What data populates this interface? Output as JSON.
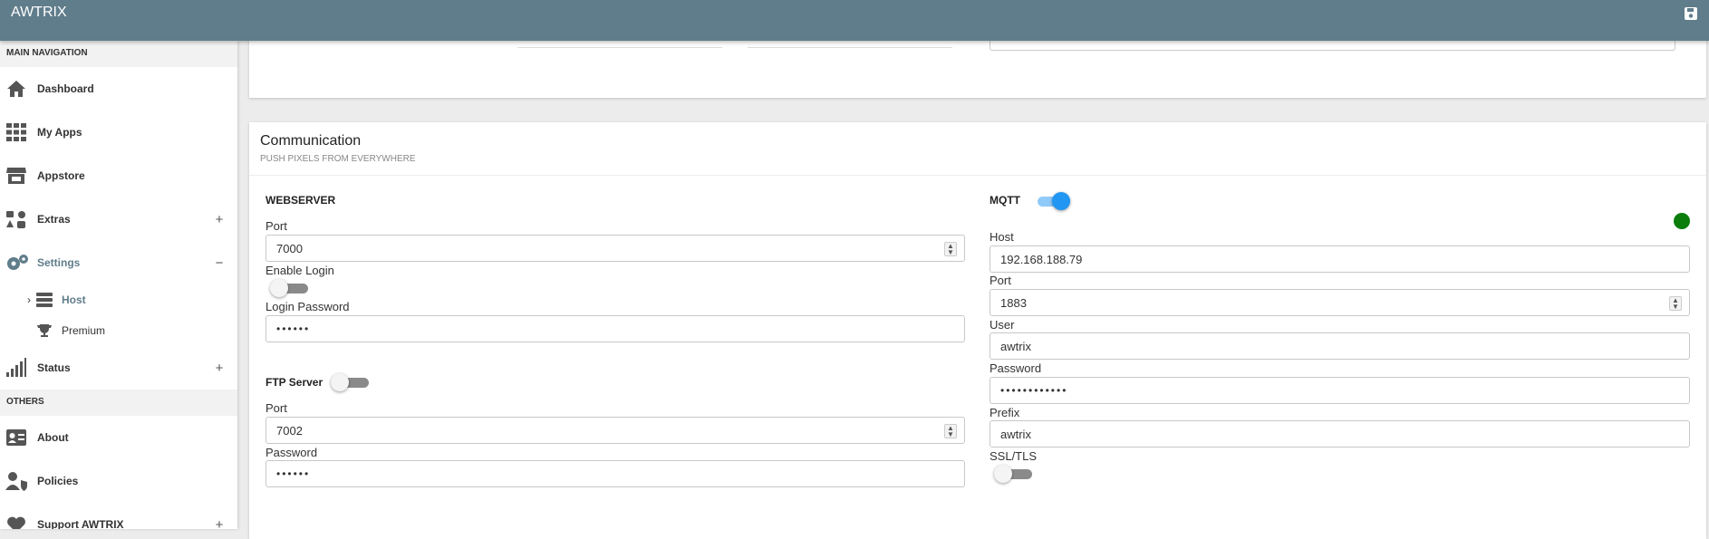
{
  "app": {
    "title": "AWTRIX"
  },
  "sidebar": {
    "main_header": "MAIN NAVIGATION",
    "items": [
      {
        "label": "Dashboard",
        "icon": "home-icon"
      },
      {
        "label": "My Apps",
        "icon": "grid-icon"
      },
      {
        "label": "Appstore",
        "icon": "store-icon"
      },
      {
        "label": "Extras",
        "icon": "extras-icon",
        "toggle": "+"
      },
      {
        "label": "Settings",
        "icon": "gears-icon",
        "toggle": "−"
      }
    ],
    "sub_items": [
      {
        "label": "Host",
        "icon": "server-icon",
        "chevron": "›"
      },
      {
        "label": "Premium",
        "icon": "trophy-icon"
      }
    ],
    "status": {
      "label": "Status",
      "icon": "signal-bars-icon",
      "toggle": "+"
    },
    "others_header": "OTHERS",
    "others": [
      {
        "label": "About",
        "icon": "id-card-icon"
      },
      {
        "label": "Policies",
        "icon": "user-shield-icon"
      },
      {
        "label": "Support AWTRIX",
        "icon": "heart-icon",
        "toggle": "+"
      }
    ]
  },
  "communication": {
    "title": "Communication",
    "subtitle": "PUSH PIXELS FROM EVERYWHERE",
    "webserver": {
      "title": "WEBSERVER",
      "port_label": "Port",
      "port_value": "7000",
      "enable_login_label": "Enable Login",
      "enable_login_on": false,
      "login_password_label": "Login Password",
      "login_password_value": "••••••"
    },
    "ftp": {
      "title": "FTP Server",
      "enabled": false,
      "port_label": "Port",
      "port_value": "7002",
      "password_label": "Password",
      "password_value": "••••••"
    },
    "mqtt": {
      "title": "MQTT",
      "enabled": true,
      "status_color": "#0a7d0a",
      "host_label": "Host",
      "host_value": "192.168.188.79",
      "port_label": "Port",
      "port_value": "1883",
      "user_label": "User",
      "user_value": "awtrix",
      "password_label": "Password",
      "password_value": "••••••••••••",
      "prefix_label": "Prefix",
      "prefix_value": "awtrix",
      "ssl_label": "SSL/TLS",
      "ssl_on": false
    }
  },
  "colors": {
    "header": "#607d8b",
    "accent": "#2196f3"
  }
}
